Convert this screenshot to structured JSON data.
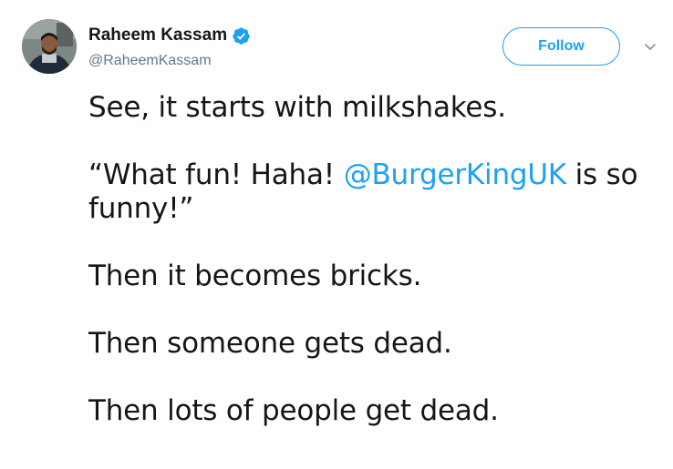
{
  "author": {
    "display_name": "Raheem Kassam",
    "handle": "@RaheemKassam",
    "verified": true,
    "verified_icon": "verified-badge-icon"
  },
  "actions": {
    "follow_label": "Follow",
    "menu_icon": "chevron-down-icon"
  },
  "colors": {
    "accent": "#1da1f2",
    "text": "#14171a",
    "secondary": "#657786"
  },
  "tweet": {
    "line1": "See, it starts with milkshakes.",
    "line2_prefix": "“What fun! Haha! ",
    "line2_mention": "@BurgerKingUK",
    "line2_suffix": " is so funny!”",
    "line3": "Then it becomes bricks.",
    "line4": "Then someone gets dead.",
    "line5": "Then lots of people get dead."
  }
}
